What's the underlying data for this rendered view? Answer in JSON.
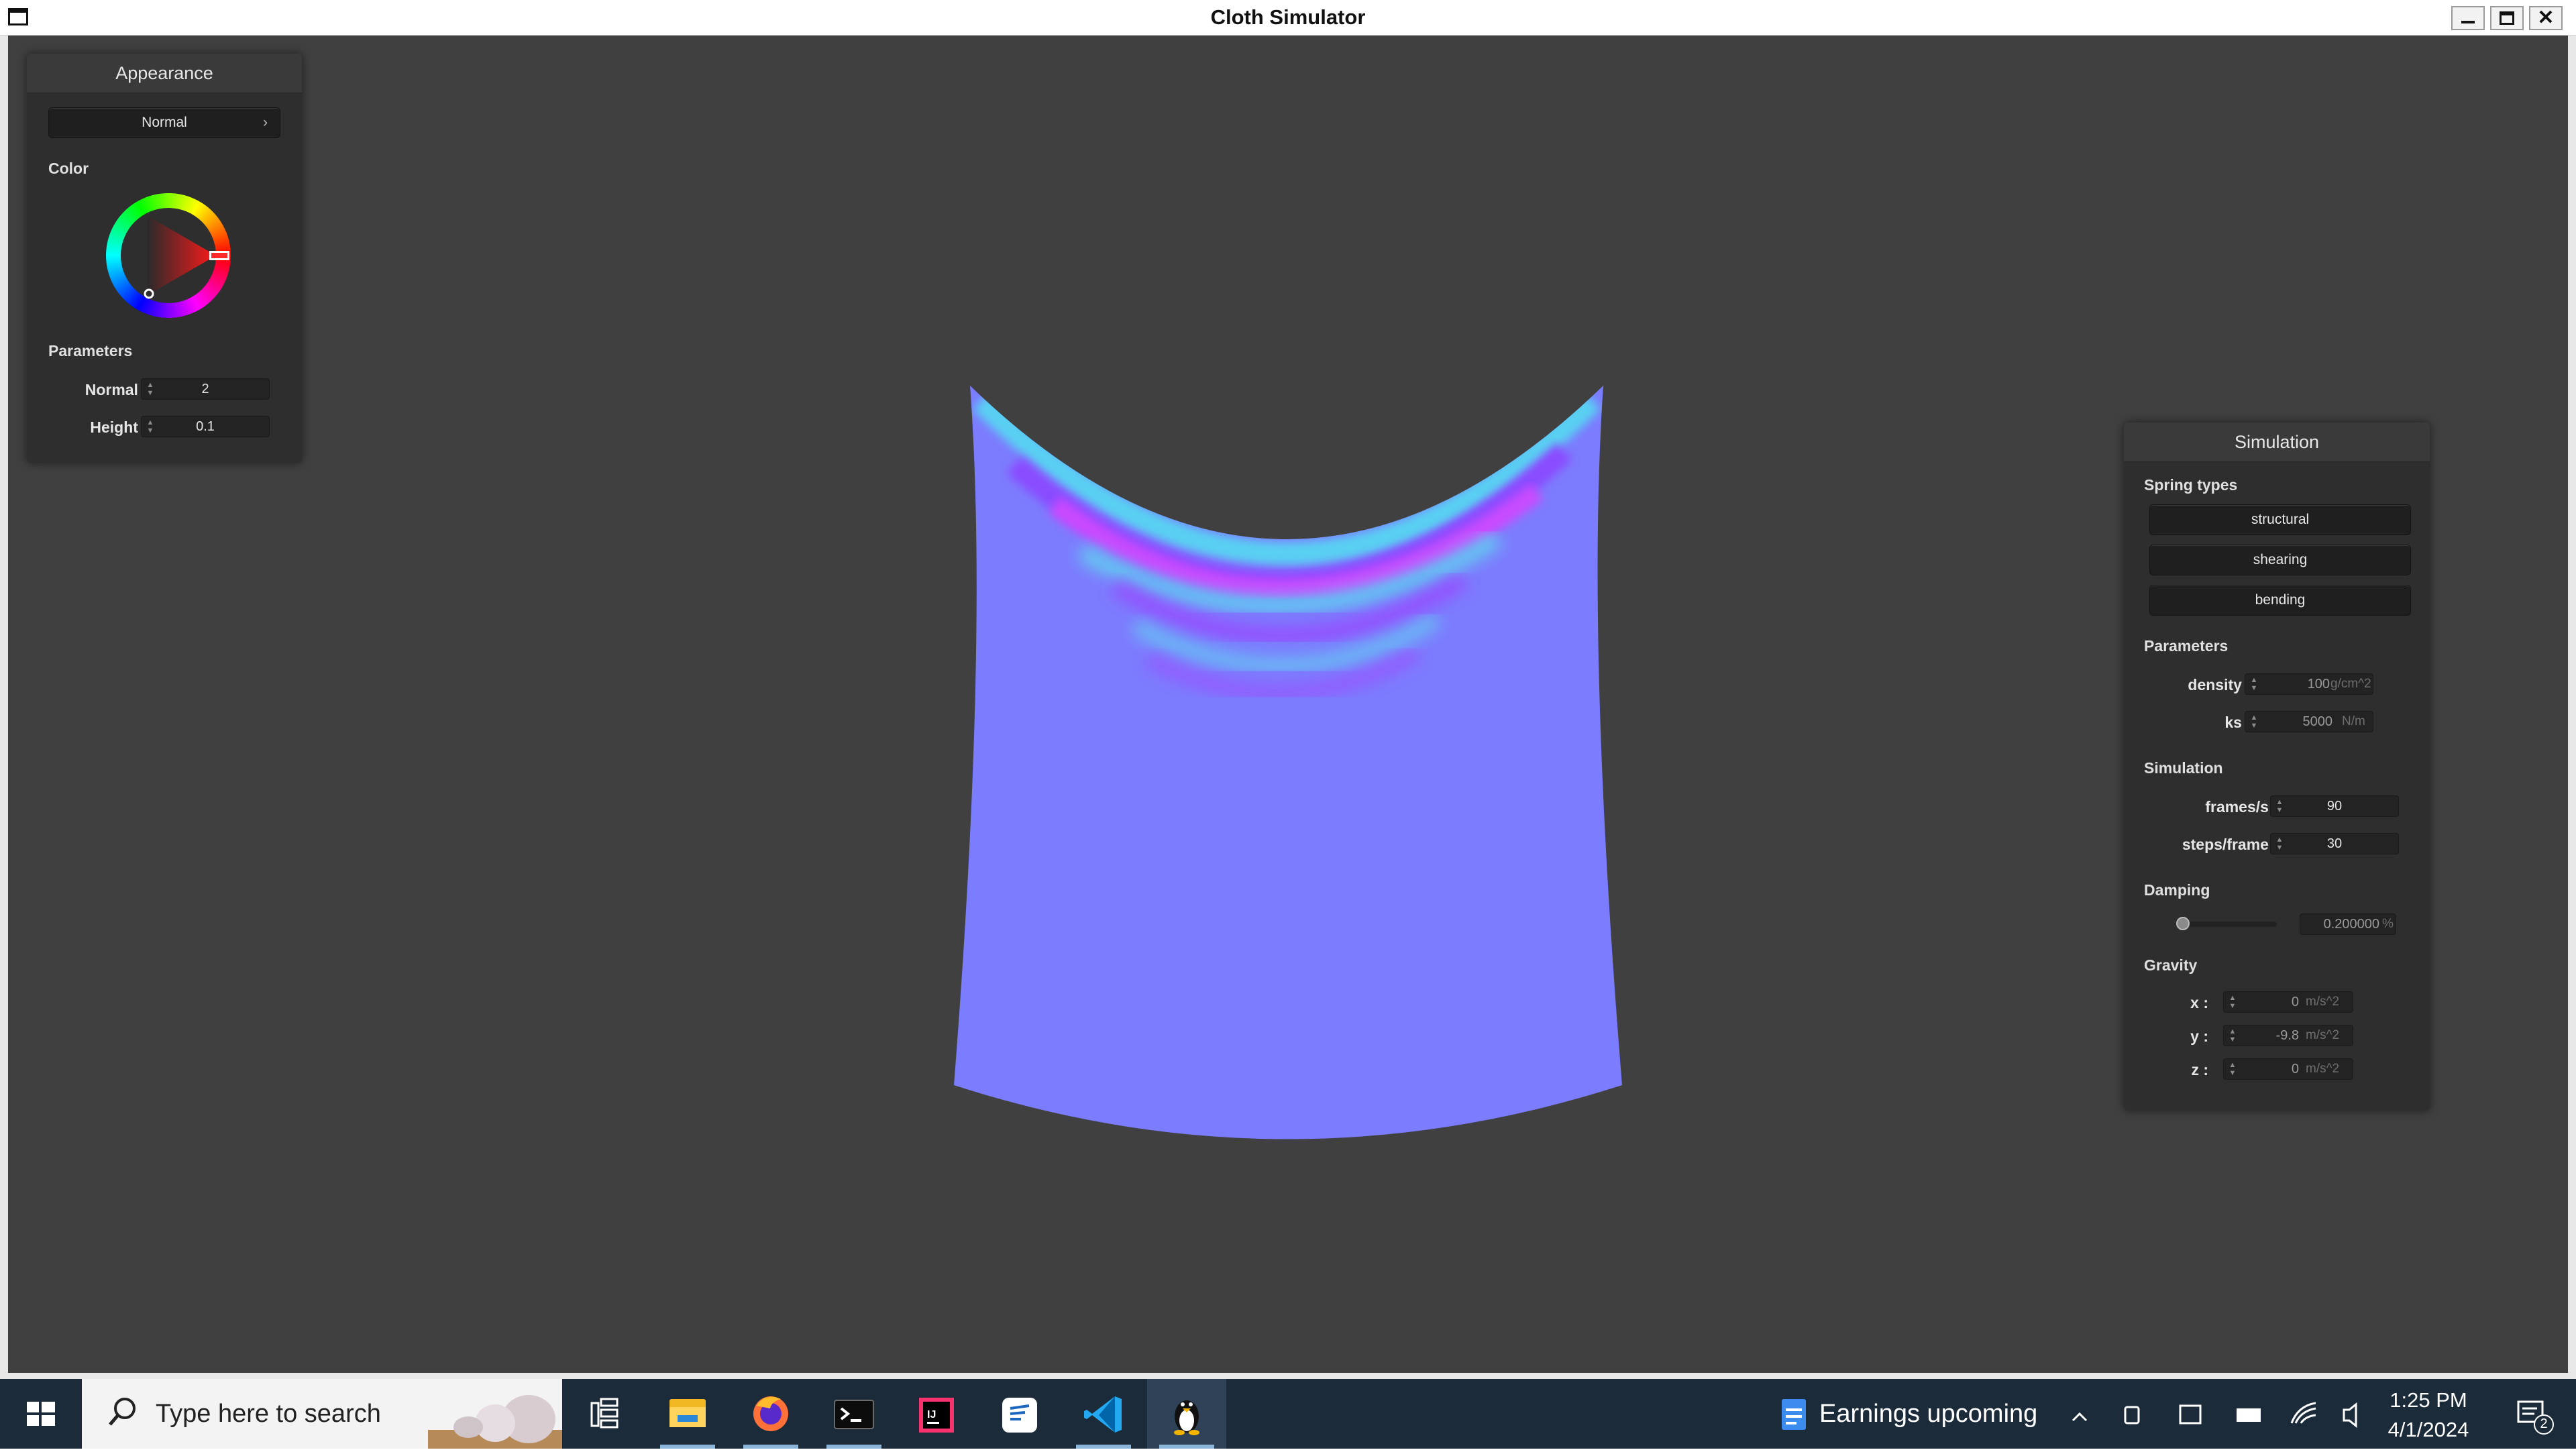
{
  "window": {
    "title": "Cloth Simulator"
  },
  "appearance_panel": {
    "header": "Appearance",
    "shader_dropdown": {
      "selected": "Normal",
      "arrow": "›"
    },
    "color_label": "Color",
    "parameters_label": "Parameters",
    "normal": {
      "label": "Normal :",
      "value": "2"
    },
    "height": {
      "label": "Height :",
      "value": "0.1"
    }
  },
  "simulation_panel": {
    "header": "Simulation",
    "spring_types_label": "Spring types",
    "spring_buttons": [
      "structural",
      "shearing",
      "bending"
    ],
    "parameters_label": "Parameters",
    "density": {
      "label": "density :",
      "value": "100",
      "unit": "g/cm^2"
    },
    "ks": {
      "label": "ks :",
      "value": "5000",
      "unit": "N/m"
    },
    "simulation_label": "Simulation",
    "frames": {
      "label": "frames/s :",
      "value": "90"
    },
    "steps": {
      "label": "steps/frame :",
      "value": "30"
    },
    "damping_label": "Damping",
    "damping": {
      "value": "0.200000",
      "unit": "%"
    },
    "gravity_label": "Gravity",
    "gravity_x": {
      "label": "x :",
      "value": "0",
      "unit": "m/s^2"
    },
    "gravity_y": {
      "label": "y :",
      "value": "-9.8",
      "unit": "m/s^2"
    },
    "gravity_z": {
      "label": "z :",
      "value": "0",
      "unit": "m/s^2"
    }
  },
  "taskbar": {
    "search_placeholder": "Type here to search",
    "notification": "Earnings upcoming",
    "time": "1:25 PM",
    "date": "4/1/2024",
    "notification_count": "2",
    "pinned_apps": [
      "task-view-icon",
      "file-explorer-icon",
      "firefox-icon",
      "terminal-icon",
      "intellij-icon",
      "notes-icon",
      "vscode-icon",
      "linux-penguin-icon"
    ]
  },
  "colors": {
    "viewport_bg": "#404040",
    "panel_bg": "#2e2e2e",
    "cloth_base": "#7c7cfe",
    "color_wheel_selected": "#ff2a2a",
    "taskbar_bg": "#1c2b3a"
  }
}
